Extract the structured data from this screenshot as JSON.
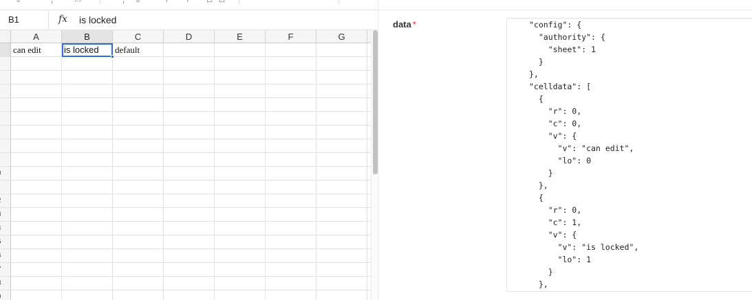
{
  "spreadsheet": {
    "name_box": "B1",
    "fx_label": "fx",
    "formula_value": "is locked",
    "columns": [
      "A",
      "B",
      "C",
      "D",
      "E",
      "F",
      "G"
    ],
    "row_markers": [
      "",
      "",
      "",
      "",
      "",
      "",
      "",
      "",
      "",
      "0",
      "",
      "2",
      "3",
      "4",
      "5",
      "6",
      "7",
      "8",
      "9"
    ],
    "cells": [
      {
        "ref": "A1",
        "value": "can edit"
      },
      {
        "ref": "B1",
        "value": "is locked",
        "selected": true
      },
      {
        "ref": "C1",
        "value": "default"
      }
    ]
  },
  "form": {
    "field_label": "data",
    "required_mark": "*",
    "code_lines": [
      "\"config\": {",
      "  \"authority\": {",
      "    \"sheet\": 1",
      "  }",
      "},",
      "\"celldata\": [",
      "  {",
      "    \"r\": 0,",
      "    \"c\": 0,",
      "    \"v\": {",
      "      \"v\": \"can edit\",",
      "      \"lo\": 0",
      "    }",
      "  },",
      "  {",
      "    \"r\": 0,",
      "    \"c\": 1,",
      "    \"v\": {",
      "      \"v\": \"is locked\",",
      "      \"lo\": 1",
      "    }",
      "  },"
    ]
  }
}
